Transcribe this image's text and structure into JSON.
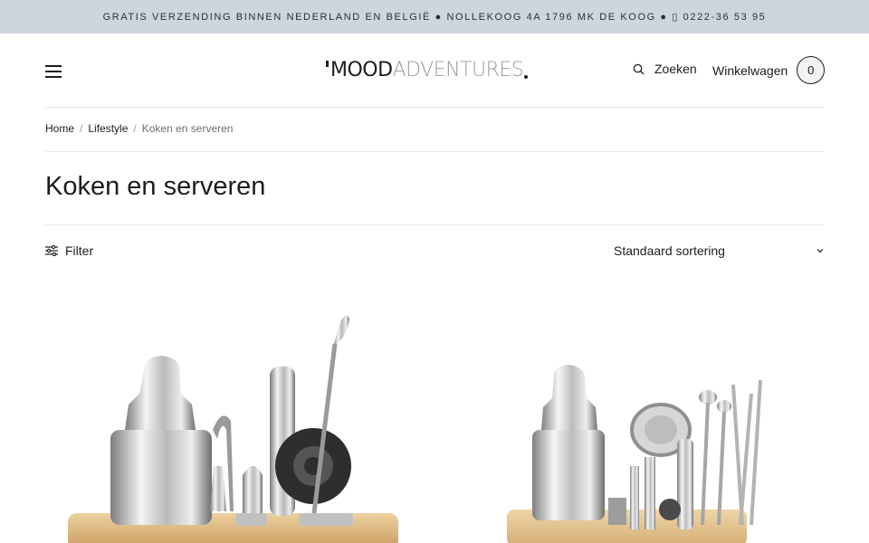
{
  "announcement": "GRATIS VERZENDING BINNEN NEDERLAND EN BELGIË ● NOLLEKOOG 4A 1796 MK DE KOOG ● ▯ 0222-36 53 95",
  "header": {
    "logo_mood": "MOOD",
    "logo_adventures": "ADVENTURES",
    "search_label": "Zoeken",
    "cart_label": "Winkelwagen",
    "cart_count": "0"
  },
  "breadcrumb": {
    "items": [
      "Home",
      "Lifestyle"
    ],
    "separator": "/",
    "current": "Koken en serveren"
  },
  "page_title": "Koken en serveren",
  "toolbar": {
    "filter_label": "Filter",
    "sort_label": "Standaard sortering"
  },
  "colors": {
    "announcement_bg": "#cdd6df",
    "text": "#1d1d1d",
    "logo_grey": "#9a9a9a",
    "bamboo": "#e2c08a"
  },
  "icons": {
    "menu": "hamburger-icon",
    "search": "search-icon",
    "filter": "sliders-icon",
    "sort": "chevron-down-icon"
  }
}
